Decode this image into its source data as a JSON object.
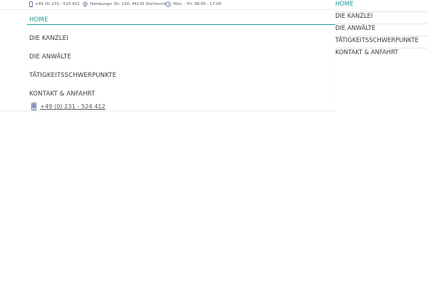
{
  "topbar": {
    "phone": "+49 (0) 231 - 524 412",
    "address": "Hamburger Str. 130, 44135 Dortmund",
    "hours": "Mon. - Fri. 08:00 - 17:00"
  },
  "main_nav": {
    "items": [
      {
        "label": "HOME",
        "active": true
      },
      {
        "label": "DIE KANZLEI"
      },
      {
        "label": "DIE ANWÄLTE"
      },
      {
        "label": "TÄTIGKEITSSCHWERPUNKTE"
      },
      {
        "label": "KONTAKT & ANFAHRT"
      }
    ],
    "phone_link": "+49 (0) 231 - 524 412"
  },
  "side_nav": {
    "items": [
      {
        "label": "HOME",
        "active": true
      },
      {
        "label": "DIE KANZLEI"
      },
      {
        "label": "DIE ANWÄLTE"
      },
      {
        "label": "TÄTIGKEITSSCHWERPUNKTE"
      },
      {
        "label": "KONTAKT & ANFAHRT"
      }
    ]
  },
  "colors": {
    "accent": "#1a9c93",
    "text": "#3a3a3a",
    "icon": "#5b6f9a"
  },
  "icons": {
    "phone": "mobile-phone-icon",
    "address": "map-pin-icon",
    "hours": "clock-icon"
  }
}
